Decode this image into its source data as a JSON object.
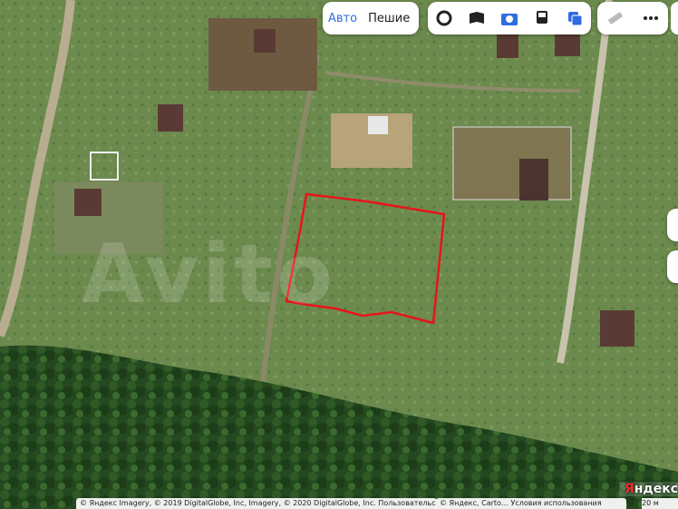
{
  "transport": {
    "car": "Авто",
    "walk": "Пешие"
  },
  "logo": {
    "first": "Я",
    "rest": "ндекс"
  },
  "copyright": {
    "imagery": "© Яндекс Imagery, © 2019 DigitalGlobe, Inc, Imagery, © 2020 DigitalGlobe, Inc. Пользовательское",
    "terms": "© Яндекс, Carto…  Условия использования"
  },
  "scale_text": "20 м",
  "watermark": "Avito",
  "icons": [
    "circle-ring-icon",
    "panorama-book-icon",
    "camera-icon",
    "bus-icon",
    "layers-icon",
    "ruler-icon",
    "more-dots-icon"
  ],
  "colors": {
    "accent": "#2f6de1",
    "plot_outline": "#e8141b"
  }
}
